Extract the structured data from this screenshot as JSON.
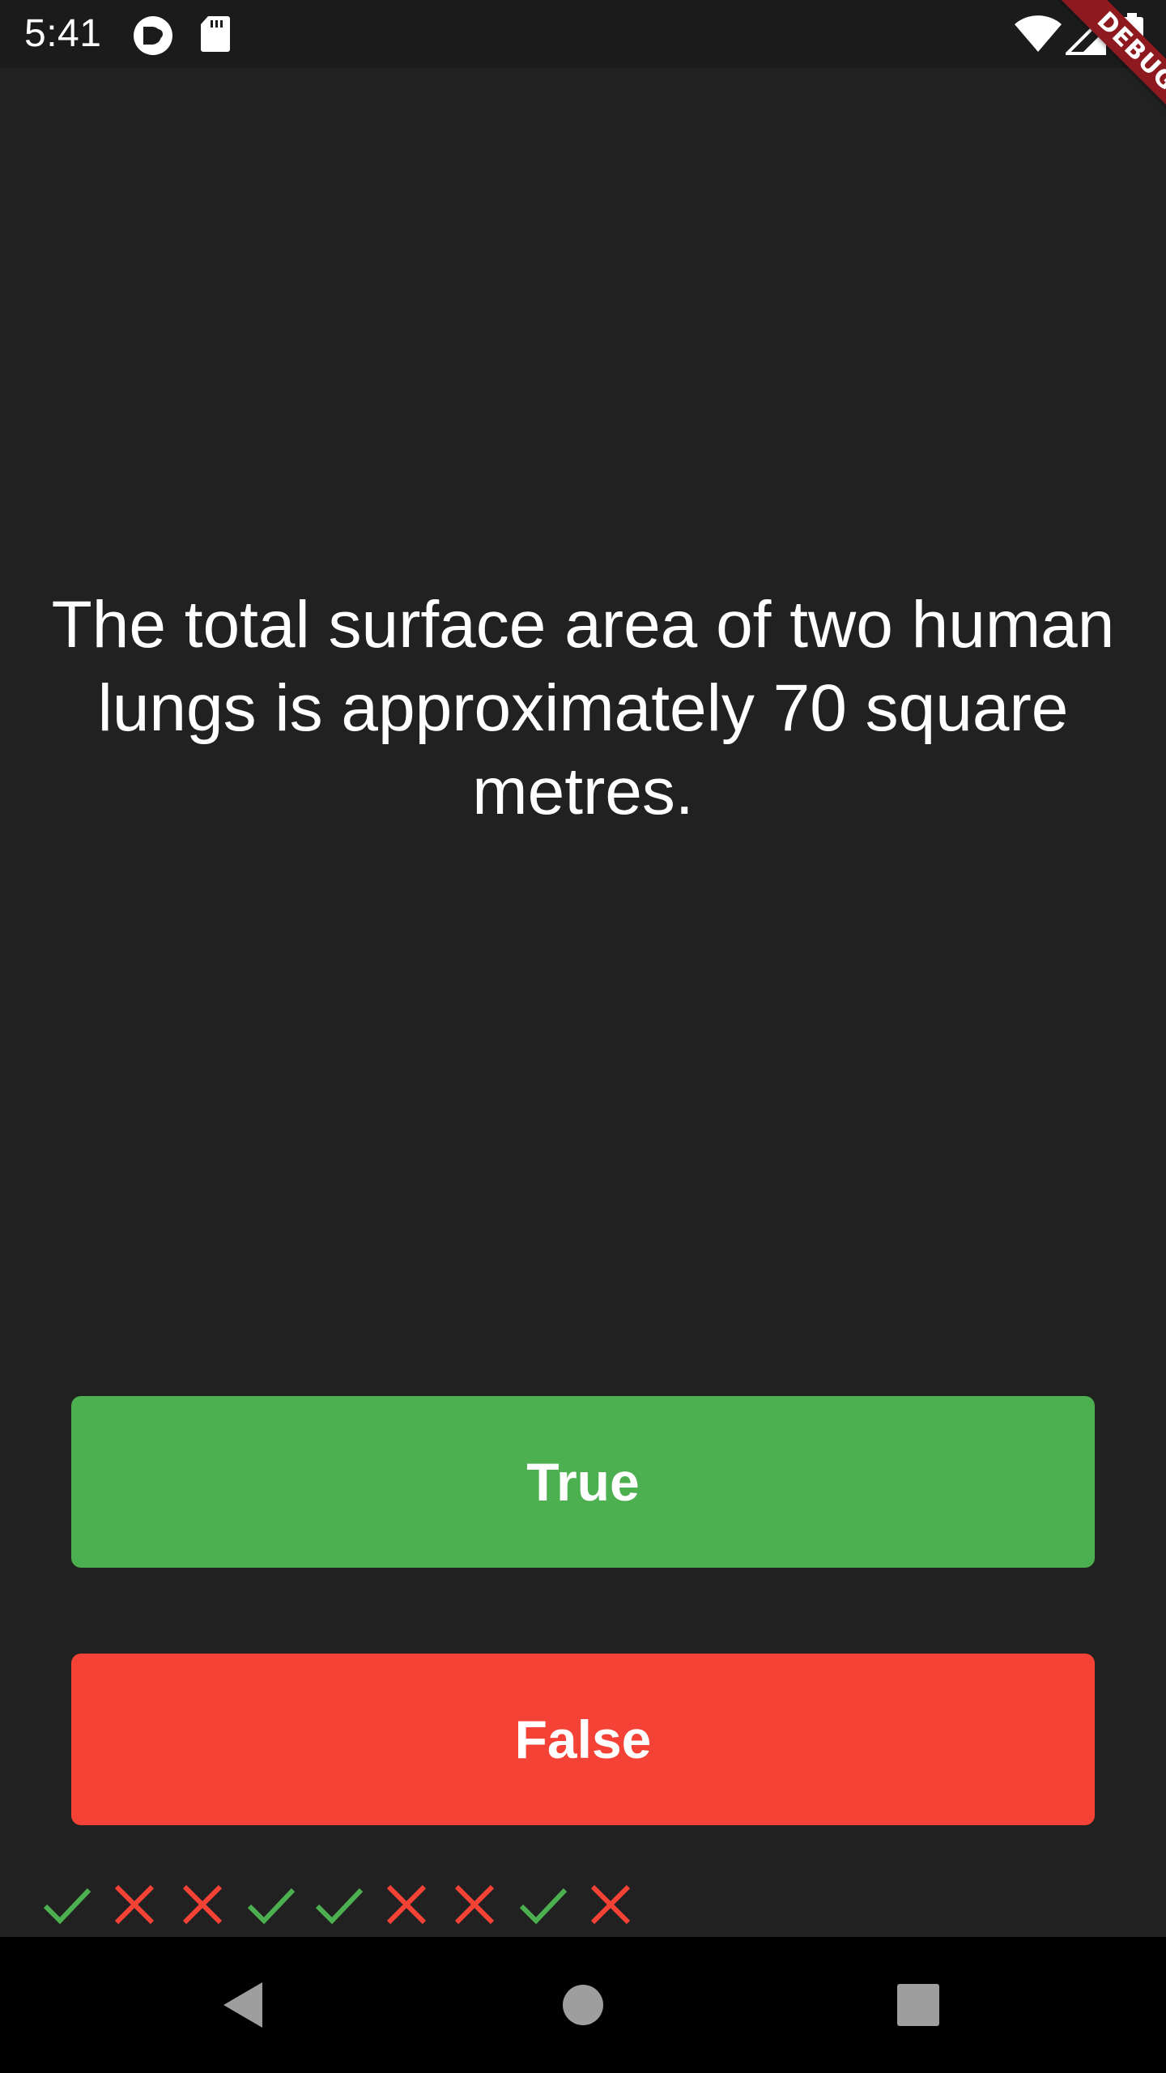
{
  "status_bar": {
    "time": "5:41",
    "left_icons": [
      "notification-circle-icon",
      "sd-card-icon"
    ],
    "right_icons": [
      "wifi-icon",
      "cell-signal-icon",
      "battery-icon"
    ]
  },
  "debug_banner": {
    "label": "DEBUG",
    "color": "#8e1a1f"
  },
  "question": {
    "text": "The total surface area of two human lungs is approximately 70 square metres."
  },
  "buttons": {
    "true_label": "True",
    "false_label": "False",
    "true_color": "#4caf50",
    "false_color": "#f44336"
  },
  "score_keeper": {
    "results": [
      "check",
      "close",
      "close",
      "check",
      "check",
      "close",
      "close",
      "check",
      "close"
    ],
    "check_color": "#4caf50",
    "close_color": "#f44336"
  },
  "nav_bar": {
    "buttons": [
      "back-icon",
      "home-icon",
      "recents-icon"
    ]
  },
  "theme": {
    "background": "#212121"
  }
}
